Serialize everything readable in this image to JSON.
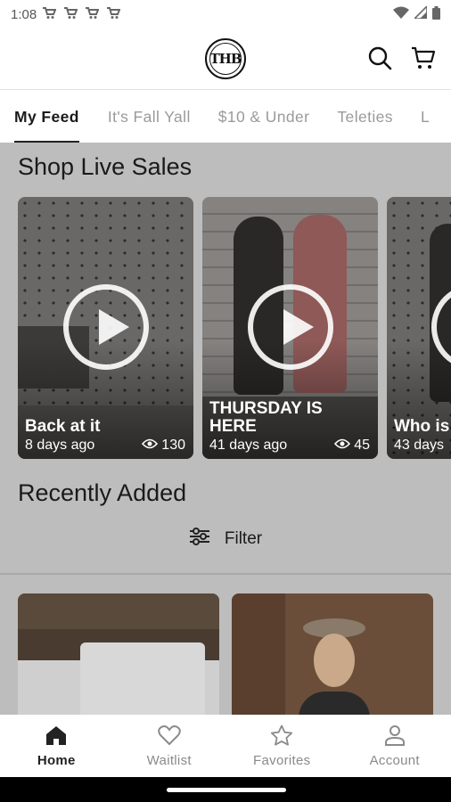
{
  "status_bar": {
    "time": "1:08",
    "notification_icons": [
      "cart-icon",
      "cart-icon",
      "cart-icon",
      "cart-icon"
    ],
    "system_icons": [
      "wifi-icon",
      "signal-icon",
      "battery-icon"
    ]
  },
  "header": {
    "logo_text": "THB",
    "search_icon": "search-icon",
    "cart_icon": "cart-icon"
  },
  "tabs": [
    "My Feed",
    "It's Fall Yall",
    "$10 & Under",
    "Teleties",
    "L"
  ],
  "live": {
    "section_title": "Shop Live Sales",
    "cards": [
      {
        "title": "Back at it",
        "ago": "8 days ago",
        "views": "130"
      },
      {
        "title": "THURSDAY IS HERE",
        "ago": "41 days ago",
        "views": "45"
      },
      {
        "title": "Who is",
        "ago": "43 days",
        "views": ""
      }
    ]
  },
  "recent": {
    "section_title": "Recently Added",
    "filter_label": "Filter"
  },
  "bottom_nav": [
    {
      "label": "Home",
      "icon": "home-icon"
    },
    {
      "label": "Waitlist",
      "icon": "heart-icon"
    },
    {
      "label": "Favorites",
      "icon": "star-icon"
    },
    {
      "label": "Account",
      "icon": "account-icon"
    }
  ],
  "colors": {
    "overlay_gray": "#bdbdbd",
    "active_text": "#1a1a1a",
    "inactive_text": "#9a9a9a"
  }
}
